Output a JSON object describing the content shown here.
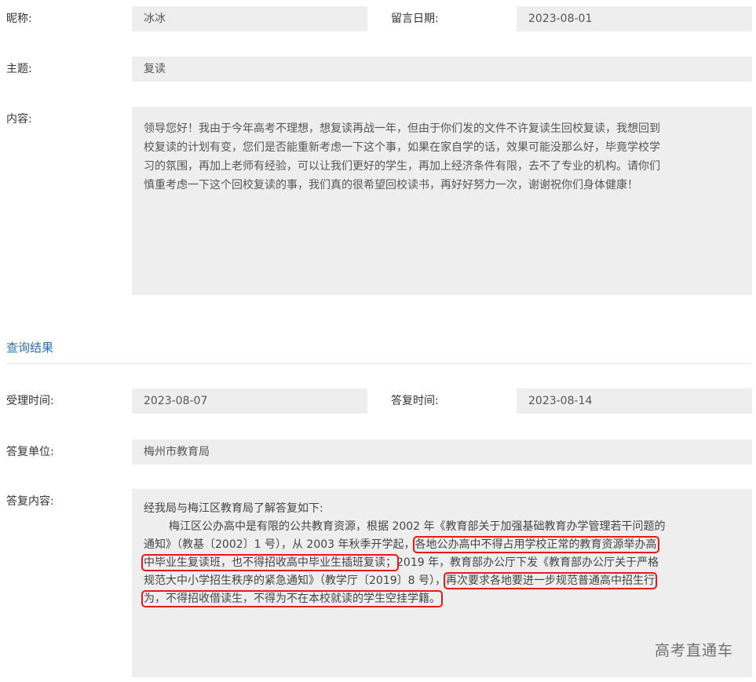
{
  "message": {
    "nickname_label": "昵称:",
    "nickname_value": "冰冰",
    "date_label": "留言日期:",
    "date_value": "2023-08-01",
    "subject_label": "主题:",
    "subject_value": "复读",
    "content_label": "内容:",
    "content_lines": [
      "领导您好！我由于今年高考不理想，想复读再战一年，但由于你们发的文件不许复读生回校复读，我想回到",
      "校复读的计划有变，您们是否能重新考虑一下这个事，如果在家自学的话，效果可能没那么好，毕竟学校学",
      "习的氛围，再加上老师有经验，可以让我们更好的学生，再加上经济条件有限，去不了专业的机构。请你们",
      "慎重考虑一下这个回校复读的事，我们真的很希望回校读书，再好好努力一次，谢谢祝你们身体健康！"
    ]
  },
  "result": {
    "section_title": "查询结果",
    "accept_time_label": "受理时间:",
    "accept_time_value": "2023-08-07",
    "reply_time_label": "答复时间:",
    "reply_time_value": "2023-08-14",
    "reply_unit_label": "答复单位:",
    "reply_unit_value": "梅州市教育局",
    "reply_content_label": "答复内容:",
    "reply": {
      "line1": "经我局与梅江区教育局了解答复如下:",
      "line2": "梅江区公办高中是有限的公共教育资源，根据 2002 年《教育部关于加强基础教育办学管理若干问题的",
      "line3_a": "通知》（教基〔2002〕1 号），从 2003 年秋季开学起，",
      "line3_b": "各地公办高中不得占用学校正常的教育资源举办高",
      "line4_a": "中毕业生复读班，也不得招收高中毕业生插班复读；",
      "line4_b": "2019 年，教育部办公厅下发《教育部办公厅关于严格",
      "line5_a": "规范大中小学招生秩序的紧急通知》（教学厅〔2019〕8 号），",
      "line5_b": "再次要求各地要进一步规范普通高中招生行",
      "line6": "为，不得招收借读生，不得为不在本校就读的学生空挂学籍。"
    },
    "watermark": "高考直通车",
    "highlight_color": "#e41b1b"
  }
}
